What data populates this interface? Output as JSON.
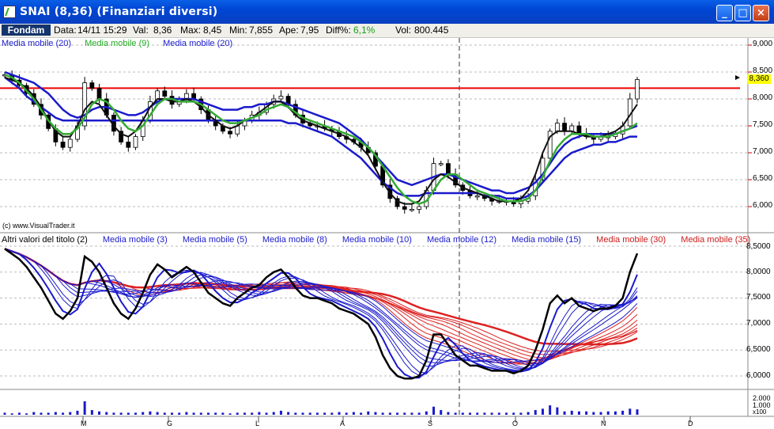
{
  "window": {
    "title": "SNAI (8,36)  (Finanziari diversi)",
    "minimize": "_",
    "maximize": "□",
    "close": "×"
  },
  "infobar": {
    "fondam": "Fondam",
    "data_label": "Data:",
    "data_value": "14/11 15:29",
    "val_label": "Val:",
    "val_value": "8,36",
    "max_label": "Max:",
    "max_value": "8,45",
    "min_label": "Min:",
    "min_value": "7,855",
    "ape_label": "Ape:",
    "ape_value": "7,95",
    "diff_label": "Diff%:",
    "diff_value": "6,1%",
    "vol_label": "Vol:",
    "vol_value": "800.445"
  },
  "top_panel": {
    "legend": [
      "Media mobile (20)",
      "Media mobile (9)",
      "Media mobile (20)"
    ],
    "legend_colors": [
      "#1a1acc",
      "#22aa22",
      "#1a1acc"
    ],
    "y_ticks": [
      "9,000",
      "8,500",
      "8,000",
      "7,500",
      "7,000",
      "6,500",
      "6,000"
    ],
    "last_price": "8,360",
    "copyright": "(c) www.VisualTrader.it"
  },
  "mid_panel": {
    "legend": [
      {
        "text": "Altri valori del titolo (2)",
        "color": "#000000"
      },
      {
        "text": "Media mobile (3)",
        "color": "#1a1acc"
      },
      {
        "text": "Media mobile (5)",
        "color": "#1a1acc"
      },
      {
        "text": "Media mobile (8)",
        "color": "#1a1acc"
      },
      {
        "text": "Media mobile (10)",
        "color": "#1a1acc"
      },
      {
        "text": "Media mobile (12)",
        "color": "#1a1acc"
      },
      {
        "text": "Media mobile (15)",
        "color": "#1a1acc"
      },
      {
        "text": "Media mobile (30)",
        "color": "#cc1a1a"
      },
      {
        "text": "Media mobile (35)",
        "color": "#cc1a1a"
      }
    ],
    "y_ticks": [
      "8,5000",
      "8,0000",
      "7,5000",
      "7,0000",
      "6,5000",
      "6,0000"
    ]
  },
  "vol_panel": {
    "y_ticks": [
      "2.000",
      "1.000",
      "x100"
    ]
  },
  "x_axis": [
    "M",
    "G",
    "L",
    "A",
    "S",
    "O",
    "N",
    "D"
  ],
  "chart_data": {
    "type": "line",
    "price_series": [
      8.45,
      8.35,
      8.25,
      8.1,
      7.9,
      7.7,
      7.45,
      7.2,
      7.1,
      7.25,
      7.5,
      8.3,
      8.2,
      8.0,
      7.7,
      7.4,
      7.2,
      7.1,
      7.3,
      7.6,
      7.95,
      8.15,
      8.05,
      7.9,
      8.0,
      8.1,
      8.0,
      7.8,
      7.6,
      7.5,
      7.4,
      7.35,
      7.5,
      7.6,
      7.7,
      7.75,
      7.9,
      8.0,
      8.05,
      7.9,
      7.7,
      7.55,
      7.5,
      7.5,
      7.45,
      7.4,
      7.3,
      7.25,
      7.2,
      7.1,
      7.0,
      6.75,
      6.4,
      6.15,
      6.0,
      5.95,
      5.95,
      6.0,
      6.3,
      6.8,
      6.8,
      6.6,
      6.4,
      6.3,
      6.2,
      6.2,
      6.15,
      6.1,
      6.1,
      6.1,
      6.05,
      6.1,
      6.2,
      6.5,
      6.9,
      7.4,
      7.55,
      7.4,
      7.5,
      7.35,
      7.3,
      7.25,
      7.3,
      7.3,
      7.35,
      7.5,
      8.0,
      8.36
    ],
    "ma_black_short": [
      8.4,
      8.35,
      8.3,
      8.2,
      8.05,
      7.85,
      7.6,
      7.4,
      7.3,
      7.3,
      7.5,
      7.8,
      7.95,
      7.9,
      7.7,
      7.5,
      7.35,
      7.3,
      7.4,
      7.6,
      7.85,
      8.0,
      8.0,
      7.95,
      7.95,
      8.0,
      7.95,
      7.85,
      7.7,
      7.6,
      7.5,
      7.45,
      7.5,
      7.6,
      7.65,
      7.75,
      7.85,
      7.95,
      7.95,
      7.85,
      7.7,
      7.6,
      7.55,
      7.5,
      7.45,
      7.4,
      7.35,
      7.3,
      7.2,
      7.1,
      6.95,
      6.7,
      6.45,
      6.25,
      6.1,
      6.05,
      6.05,
      6.1,
      6.3,
      6.5,
      6.6,
      6.55,
      6.45,
      6.35,
      6.3,
      6.25,
      6.2,
      6.15,
      6.1,
      6.1,
      6.1,
      6.15,
      6.3,
      6.6,
      7.0,
      7.3,
      7.4,
      7.4,
      7.4,
      7.35,
      7.3,
      7.3,
      7.3,
      7.35,
      7.4,
      7.5,
      7.7,
      7.9
    ],
    "ma9_green": [
      8.45,
      8.4,
      8.3,
      8.15,
      8.0,
      7.8,
      7.6,
      7.45,
      7.35,
      7.35,
      7.45,
      7.65,
      7.9,
      8.0,
      7.95,
      7.8,
      7.6,
      7.45,
      7.4,
      7.5,
      7.7,
      7.9,
      8.0,
      8.0,
      7.95,
      7.95,
      7.95,
      7.9,
      7.8,
      7.7,
      7.6,
      7.55,
      7.55,
      7.6,
      7.65,
      7.7,
      7.8,
      7.85,
      7.9,
      7.85,
      7.75,
      7.65,
      7.6,
      7.55,
      7.5,
      7.45,
      7.4,
      7.35,
      7.3,
      7.2,
      7.1,
      6.95,
      6.75,
      6.55,
      6.35,
      6.2,
      6.1,
      6.05,
      6.1,
      6.3,
      6.5,
      6.6,
      6.6,
      6.5,
      6.4,
      6.3,
      6.25,
      6.2,
      6.15,
      6.1,
      6.1,
      6.1,
      6.15,
      6.3,
      6.55,
      6.85,
      7.1,
      7.25,
      7.35,
      7.35,
      7.35,
      7.3,
      7.3,
      7.3,
      7.35,
      7.4,
      7.45,
      7.55
    ],
    "ma20_upper": [
      8.5,
      8.45,
      8.4,
      8.35,
      8.3,
      8.2,
      8.1,
      7.95,
      7.8,
      7.7,
      7.65,
      7.7,
      7.8,
      7.85,
      7.85,
      7.8,
      7.75,
      7.7,
      7.7,
      7.75,
      7.85,
      7.95,
      8.0,
      8.0,
      8.0,
      8.0,
      8.0,
      7.95,
      7.9,
      7.85,
      7.8,
      7.8,
      7.8,
      7.85,
      7.85,
      7.9,
      7.9,
      7.95,
      7.95,
      7.9,
      7.85,
      7.8,
      7.75,
      7.7,
      7.65,
      7.6,
      7.55,
      7.45,
      7.35,
      7.25,
      7.1,
      6.95,
      6.8,
      6.65,
      6.5,
      6.45,
      6.4,
      6.45,
      6.5,
      6.55,
      6.6,
      6.6,
      6.55,
      6.5,
      6.45,
      6.4,
      6.35,
      6.3,
      6.3,
      6.25,
      6.25,
      6.3,
      6.35,
      6.45,
      6.6,
      6.8,
      7.0,
      7.15,
      7.25,
      7.3,
      7.35,
      7.35,
      7.35,
      7.35,
      7.35,
      7.4,
      7.45,
      7.5
    ],
    "ma20_lower": [
      8.4,
      8.3,
      8.2,
      8.05,
      7.95,
      7.85,
      7.75,
      7.65,
      7.6,
      7.6,
      7.6,
      7.6,
      7.6,
      7.6,
      7.6,
      7.6,
      7.6,
      7.6,
      7.6,
      7.6,
      7.6,
      7.6,
      7.6,
      7.6,
      7.6,
      7.6,
      7.6,
      7.6,
      7.6,
      7.6,
      7.6,
      7.6,
      7.6,
      7.6,
      7.6,
      7.6,
      7.6,
      7.6,
      7.6,
      7.55,
      7.55,
      7.5,
      7.45,
      7.4,
      7.35,
      7.3,
      7.2,
      7.1,
      7.0,
      6.9,
      6.75,
      6.6,
      6.45,
      6.35,
      6.25,
      6.2,
      6.2,
      6.2,
      6.25,
      6.25,
      6.25,
      6.25,
      6.25,
      6.25,
      6.25,
      6.25,
      6.2,
      6.2,
      6.2,
      6.15,
      6.15,
      6.15,
      6.2,
      6.3,
      6.45,
      6.6,
      6.75,
      6.9,
      7.0,
      7.05,
      7.1,
      7.15,
      7.15,
      7.2,
      7.2,
      7.25,
      7.3,
      7.3
    ],
    "volume_x100": [
      3,
      2,
      3,
      2,
      4,
      3,
      3,
      4,
      3,
      4,
      6,
      20,
      7,
      5,
      4,
      3,
      3,
      3,
      3,
      4,
      5,
      4,
      3,
      3,
      3,
      4,
      3,
      3,
      3,
      3,
      3,
      2,
      3,
      3,
      3,
      4,
      3,
      4,
      6,
      4,
      3,
      3,
      3,
      3,
      3,
      3,
      4,
      3,
      4,
      3,
      5,
      4,
      3,
      3,
      3,
      3,
      3,
      3,
      5,
      12,
      7,
      4,
      3,
      3,
      3,
      3,
      3,
      3,
      3,
      3,
      3,
      3,
      4,
      7,
      9,
      14,
      11,
      5,
      6,
      5,
      5,
      4,
      4,
      5,
      5,
      6,
      9,
      8
    ]
  }
}
